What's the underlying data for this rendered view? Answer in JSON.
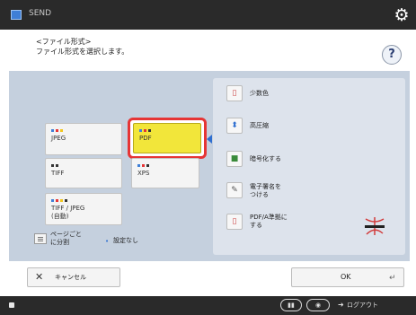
{
  "top_bar": {
    "title": "SEND",
    "settings_icon": "gear-icon"
  },
  "header": {
    "line1": "<ファイル形式>",
    "line2": "ファイル形式を選択します。",
    "help_label": "?"
  },
  "formats": {
    "jpeg": "JPEG",
    "pdf": "PDF",
    "tiff": "TIFF",
    "xps": "XPS",
    "tiff_jpeg_l1": "TIFF / JPEG",
    "tiff_jpeg_l2": "(自動)",
    "selected": "pdf"
  },
  "split": {
    "label_l1": "ページごと",
    "label_l2": "に分割",
    "bullet": "•",
    "value": "設定なし"
  },
  "options": {
    "few_colors": "少数色",
    "high_compression": "高圧縮",
    "encrypt": "暗号化する",
    "signature_l1": "電子署名を",
    "signature_l2": "つける",
    "pdfa_l1": "PDF/A準拠に",
    "pdfa_l2": "する"
  },
  "bottom": {
    "cancel_symbol": "✕",
    "cancel_label": "キャンセル",
    "ok_label": "OK",
    "ok_enter_symbol": "↵"
  },
  "status_bar": {
    "logout_label": "ログアウト"
  },
  "colors": {
    "selected_fill": "#f2e63a",
    "selection_outline": "#e63535",
    "panel": "#c5d0de",
    "bar": "#2a2a2a"
  }
}
